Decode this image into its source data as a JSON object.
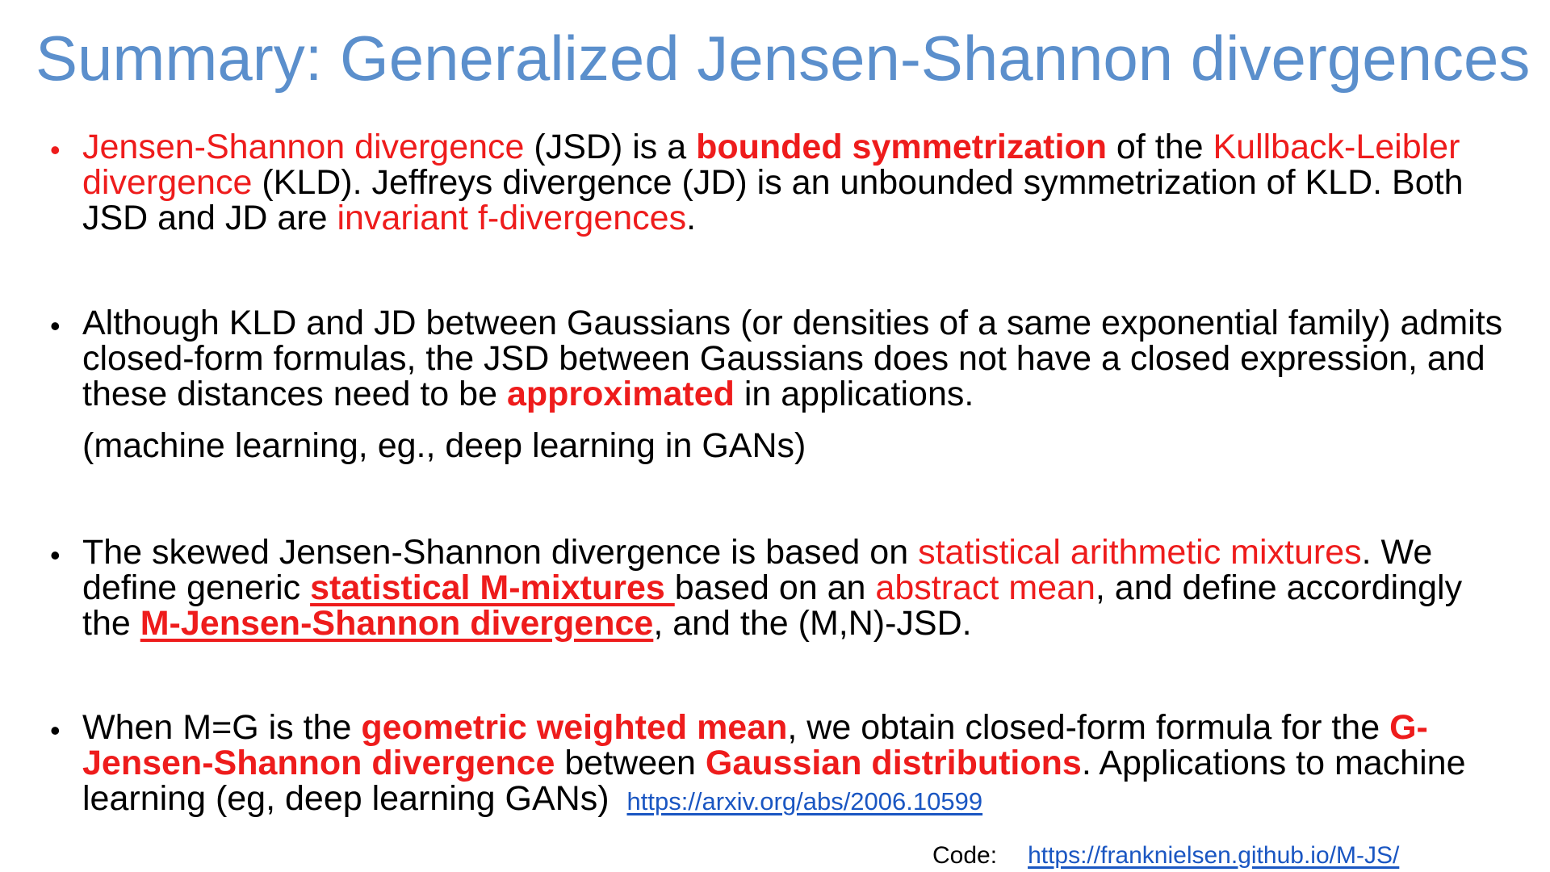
{
  "title": "Summary: Generalized Jensen-Shannon divergences",
  "colors": {
    "title": "#5b8fcc",
    "accent_red": "#ee1c1c",
    "link": "#1a56c2"
  },
  "bullet1": {
    "marker": "•",
    "p1": "Jensen-Shannon divergence",
    "p2": " (JSD) is a ",
    "p3": "bounded symmetrization",
    "p4": " of the ",
    "p5": "Kullback-Leibler divergence",
    "p6": " (KLD). Jeffreys divergence (JD) is an unbounded symmetrization of KLD. Both JSD and JD are ",
    "p7": "invariant f-divergences",
    "p8": "."
  },
  "bullet2": {
    "marker": "•",
    "p1": "Although KLD and JD between Gaussians (or densities of a same exponential family) admits closed-form formulas, the JSD between Gaussians does not have a closed expression, and these distances need to be ",
    "p2": "approximated",
    "p3": " in applications.",
    "note": "(machine learning, eg., deep learning in GANs)"
  },
  "bullet3": {
    "marker": "•",
    "p1": "The skewed Jensen-Shannon divergence is based on ",
    "p2": "statistical arithmetic mixtures",
    "p3": ". We define generic ",
    "p4": "statistical M-mixtures ",
    "p5": "based on an ",
    "p6": "abstract mean",
    "p7": ", and define accordingly the ",
    "p8": "M-Jensen-Shannon divergence",
    "p9": ", and the (M,N)-JSD."
  },
  "bullet4": {
    "marker": "•",
    "p1": "When M=G is the ",
    "p2": "geometric weighted mean",
    "p3": ", we obtain closed-form formula for the ",
    "p4": "G-Jensen-Shannon divergence",
    "p5": " between ",
    "p6": "Gaussian distributions",
    "p7": ". Applications to machine learning (eg, deep learning GANs) ",
    "link": "https://arxiv.org/abs/2006.10599"
  },
  "code": {
    "label": "Code:",
    "link": "https://franknielsen.github.io/M-JS/"
  }
}
